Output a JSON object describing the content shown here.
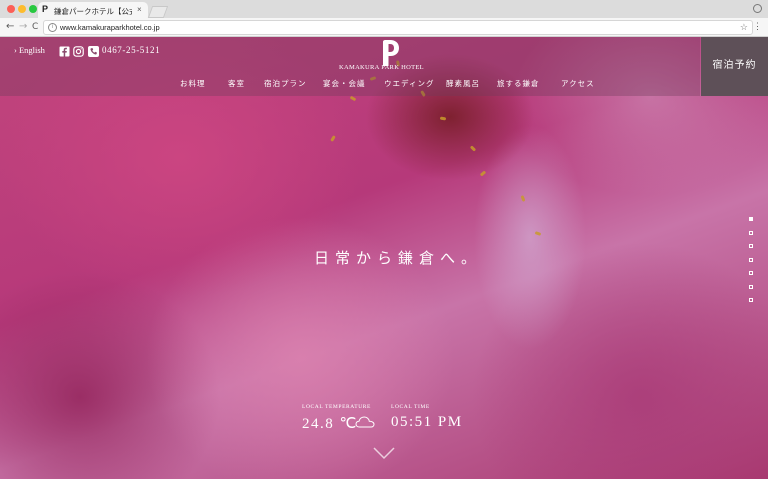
{
  "browser": {
    "tab_title": "鎌倉パークホテル【公式】 | Ka",
    "tab_close": "×",
    "url": "www.kamakuraparkhotel.co.jp",
    "back": "←",
    "forward": "→",
    "reload": "C",
    "star": "☆",
    "menu": "⋮",
    "info": "i"
  },
  "header": {
    "lang_link": "› English",
    "phone": "0467-25-5121",
    "logo_text": "KAMAKURA PARK HOTEL",
    "booking_label": "宿泊予約",
    "social_icons": [
      "facebook-icon",
      "instagram-icon",
      "phone-icon"
    ]
  },
  "nav": {
    "items": [
      "お料理",
      "客室",
      "宿泊プラン",
      "宴会・会議",
      "ウエディング",
      "酵素風呂",
      "旅する鎌倉",
      "アクセス"
    ]
  },
  "hero": {
    "tagline": "日常から鎌倉へ。",
    "slides_total": 7,
    "active_slide": 1
  },
  "info": {
    "temp_label": "LOCAL TEMPERATURE",
    "temp_value": "24.8 ℃",
    "weather_icon": "cloud-icon",
    "time_label": "LOCAL TIME",
    "time_value": "05:51 PM"
  },
  "colors": {
    "booking_bg": "#5e5058",
    "header_overlay": "rgba(110,60,90,0.35)",
    "text": "#ffffff"
  }
}
